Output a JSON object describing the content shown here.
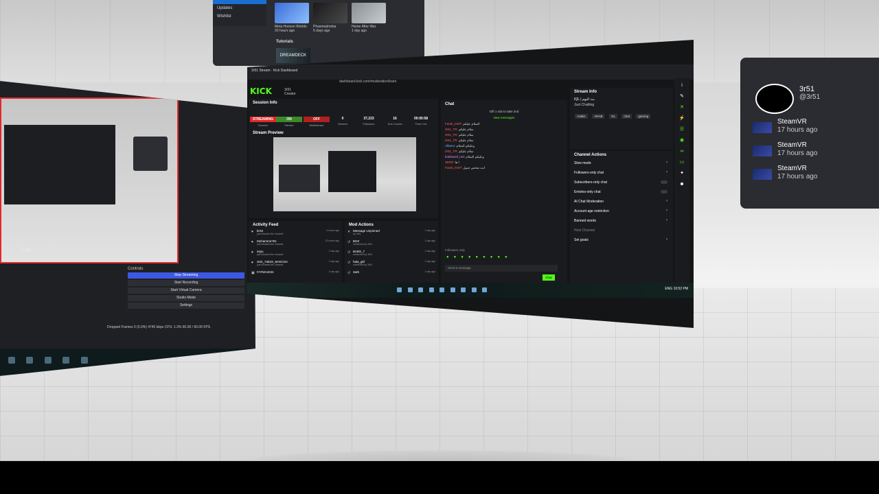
{
  "store": {
    "side_items": [
      "Updates",
      "Wishlist"
    ],
    "games": [
      {
        "name": "Meta Horizon Worlds",
        "date": "20 hours ago"
      },
      {
        "name": "Phasmophobia",
        "date": "5 days ago"
      },
      {
        "name": "Home After War",
        "date": "1 day ago"
      }
    ],
    "tutorials_label": "Tutorials",
    "tutorial_tile": "DREAMDECK"
  },
  "obs": {
    "status_strip": "71 px",
    "controls_header": "Controls",
    "controls": [
      "Stop Streaming",
      "Start Recording",
      "Start Virtual Camera",
      "Studio Mode",
      "Settings"
    ],
    "footer": "Dropped Frames 0 (0.0%)   4740 kbps   CPU: 1.3%   60.00 / 60.00 FPS"
  },
  "browser": {
    "tab_title": "3r51 Stream - Kick Dashboard",
    "url": "dashboard.kick.com/moderation/learn"
  },
  "kick": {
    "logo": "KICK",
    "user": "3r51",
    "user_role": "Creator",
    "session": {
      "title": "Session Info",
      "stats": [
        {
          "value": "STREAMING",
          "label": "Session"
        },
        {
          "value": "ON",
          "label": "Partner"
        },
        {
          "value": "OFF",
          "label": "Multistream"
        },
        {
          "value": "0",
          "label": "Viewers"
        },
        {
          "value": "37,223",
          "label": "Followers"
        },
        {
          "value": "16",
          "label": "Sub Counts"
        },
        {
          "value": "00:00:58",
          "label": "Time Live"
        }
      ]
    },
    "preview_title": "Stream Preview",
    "activity": {
      "title": "Activity Feed",
      "items": [
        {
          "name": "br33",
          "desc": "just followed the channel",
          "time": "4 hours ago"
        },
        {
          "name": "Mohamme?91",
          "desc": "just followed the channel",
          "time": "22 hours ago"
        },
        {
          "name": "sspu",
          "desc": "just followed the channel",
          "time": "1 day ago"
        },
        {
          "name": "3mk_7abeS_MAEO24",
          "desc": "just followed the channel",
          "time": "1 day ago"
        },
        {
          "name": "FATMA3234",
          "desc": "",
          "time": "1 day ago"
        }
      ]
    },
    "mod": {
      "title": "Mod Actions",
      "items": [
        {
          "name": "Message Unpinned",
          "desc": "by 3r51",
          "time": "1 day ago"
        },
        {
          "name": "BOZ",
          "desc": "unbanned by 3r51",
          "time": "1 day ago"
        },
        {
          "name": "BABS_7",
          "desc": "unbanned by 3r51",
          "time": "1 day ago"
        },
        {
          "name": "hala_girl",
          "desc": "unbanned by 3r51",
          "time": "1 day ago"
        },
        {
          "name": "3arb",
          "desc": "",
          "time": "1 day ago"
        }
      ]
    },
    "chat": {
      "title": "Chat",
      "pinned": "Gift 1 sub to take 2nd",
      "new_messages": "New messages",
      "lines": [
        {
          "user": "Farah_KWT:",
          "text": "السلام عليكم"
        },
        {
          "user": "3r51_TR:",
          "text": "سلام عليكم"
        },
        {
          "user": "3r51_TR:",
          "text": "سلام عليكم"
        },
        {
          "user": "3r51_TR:",
          "text": "سلام عليكم"
        },
        {
          "user": "Albano:",
          "text": "وعليكم السلام"
        },
        {
          "user": "3r51_TR:",
          "text": "سلام عليكم"
        },
        {
          "user": "bottlewell_red:",
          "text": "وعليكم السلام"
        },
        {
          "user": "3ERR:",
          "text": "ا ها"
        },
        {
          "user": "Farah_KWT:",
          "text": "انت شخص جميل"
        }
      ],
      "followers_only": "Followers only",
      "input_placeholder": "Send a message",
      "send_label": "Chat"
    },
    "stream_info": {
      "title": "Stream Info",
      "stream_title": "IQL | بث اليوم",
      "category": "Just Chatting",
      "tags": [
        "Arabic",
        "ARAB",
        "OL",
        "chat",
        "gaming"
      ]
    },
    "channel_actions": {
      "title": "Channel Actions",
      "rows": [
        {
          "label": "Slow mode",
          "kind": "chev"
        },
        {
          "label": "Followers-only chat",
          "kind": "chev",
          "sub": "1 min"
        },
        {
          "label": "Subscribers-only chat",
          "kind": "toggle"
        },
        {
          "label": "Emotes-only chat",
          "kind": "toggle"
        },
        {
          "label": "AI Chat Moderation",
          "kind": "chev"
        },
        {
          "label": "Account age restriction",
          "kind": "chev"
        },
        {
          "label": "Banned words",
          "kind": "chev"
        },
        {
          "label": "Host Channel",
          "kind": "none",
          "dim": true
        },
        {
          "label": "Set goals",
          "kind": "chev",
          "sub": "2 active"
        }
      ]
    },
    "taskbar_clock": "10:52 PM",
    "taskbar_lang": "ENG"
  },
  "steam": {
    "profile_name": "3r51",
    "profile_handle": "@3r51",
    "notifications": [
      {
        "title": "SteamVR",
        "time": "17 hours ago"
      },
      {
        "title": "SteamVR",
        "time": "17 hours ago"
      },
      {
        "title": "SteamVR",
        "time": "17 hours ago"
      }
    ]
  },
  "colors": {
    "kick_green": "#53fc18",
    "obs_accent": "#3d58e2",
    "live_red": "#e02a2a"
  }
}
